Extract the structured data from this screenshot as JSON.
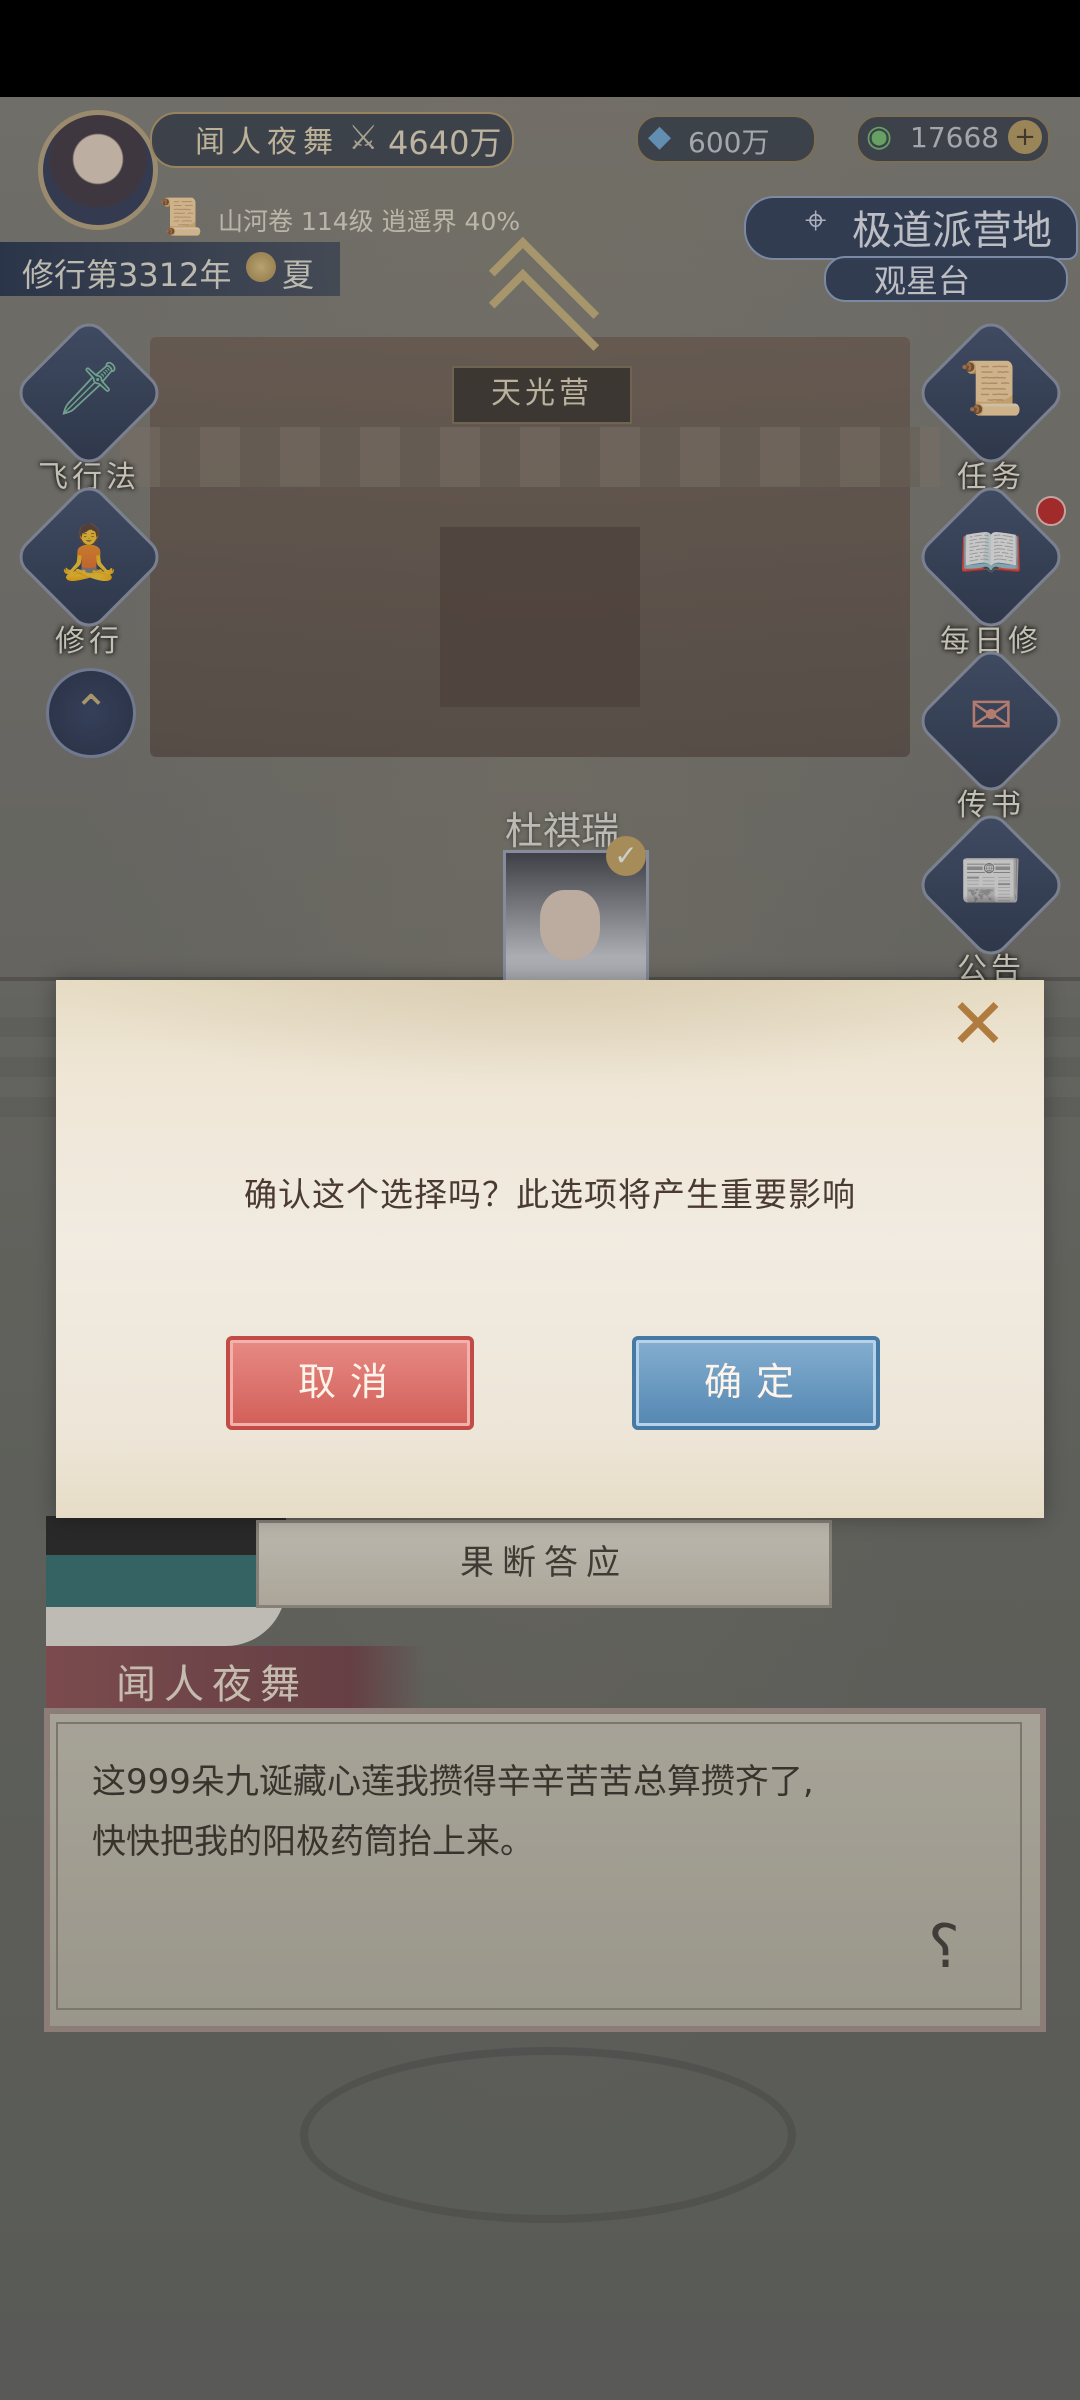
{
  "player": {
    "name": "闻人夜舞",
    "combat_power": "4640万",
    "resource_1": "600万",
    "resource_2": "17668",
    "level_info": "山河卷 114级 逍遥界 40%",
    "year": "修行第3312年",
    "season": "夏"
  },
  "location": {
    "title": "极道派营地",
    "subtitle": "观星台",
    "camp_sign": "天光营"
  },
  "side_menu_left": [
    {
      "label": "飞行法器",
      "icon": "flying-artifact-icon"
    },
    {
      "label": "修行",
      "icon": "cultivation-icon"
    }
  ],
  "side_menu_right": [
    {
      "label": "任务",
      "icon": "quest-scroll-icon"
    },
    {
      "label": "每日修行",
      "icon": "daily-book-icon"
    },
    {
      "label": "传书",
      "icon": "letter-icon"
    },
    {
      "label": "公告",
      "icon": "notice-icon"
    }
  ],
  "npc": {
    "name": "杜祺瑞"
  },
  "dialog": {
    "choice": "果断答应",
    "speaker": "闻人夜舞",
    "text_line1": "这999朵九诞藏心莲我攒得辛辛苦苦总算攒齐了,",
    "text_line2": "快快把我的阳极药筒抬上来。"
  },
  "modal": {
    "message": "确认这个选择吗？此选项将产生重要影响",
    "cancel_label": "取消",
    "confirm_label": "确定"
  },
  "colors": {
    "cancel_button": "#d25f58",
    "confirm_button": "#5487b2",
    "hud_navy": "#1e2d50"
  }
}
